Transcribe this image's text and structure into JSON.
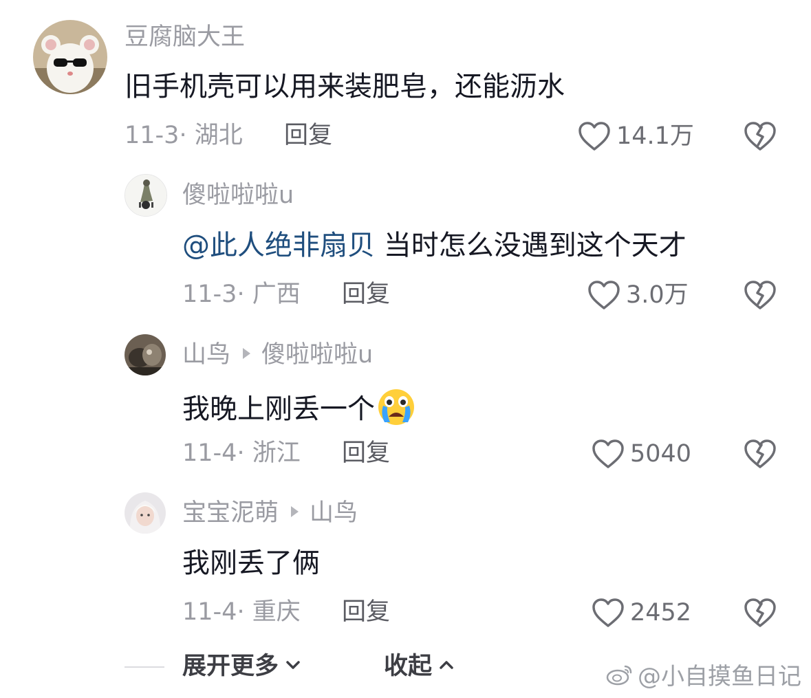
{
  "comments": [
    {
      "username": "豆腐脑大王",
      "text": "旧手机壳可以用来装肥皂，还能沥水",
      "date": "11-3",
      "location": "湖北",
      "reply_label": "回复",
      "likes": "14.1万"
    },
    {
      "username": "傻啦啦啦u",
      "mention": "@此人绝非扇贝",
      "text": " 当时怎么没遇到这个天才",
      "date": "11-3",
      "location": "广西",
      "reply_label": "回复",
      "likes": "3.0万"
    },
    {
      "username": "山鸟",
      "reply_to": "傻啦啦啦u",
      "text": "我晚上刚丢一个",
      "emoji": "crying-face-emoji",
      "date": "11-4",
      "location": "浙江",
      "reply_label": "回复",
      "likes": "5040"
    },
    {
      "username": "宝宝泥萌",
      "reply_to": "山鸟",
      "text": "我刚丢了俩",
      "date": "11-4",
      "location": "重庆",
      "reply_label": "回复",
      "likes": "2452"
    }
  ],
  "footer": {
    "expand_label": "展开更多",
    "collapse_label": "收起"
  },
  "watermark": "@小自摸鱼日记",
  "colors": {
    "mention": "#1f4e7e",
    "meta": "#9a9ba2",
    "text": "#161823"
  }
}
